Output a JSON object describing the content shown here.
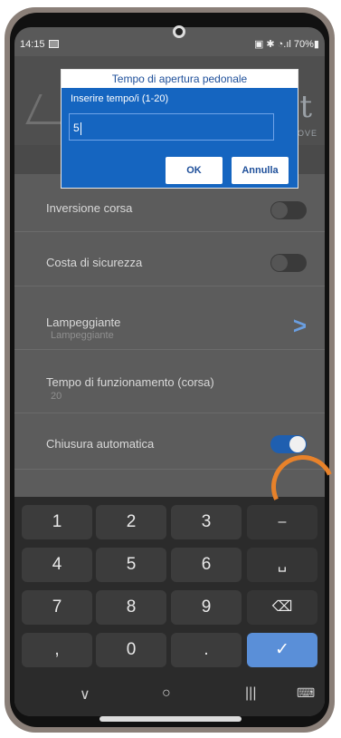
{
  "status": {
    "time": "14:15",
    "right": "▣ ✱ ◔.ıl 70%▮"
  },
  "header": {
    "logo_text": "t",
    "logo_sub": "OVE"
  },
  "dialog": {
    "title": "Tempo di apertura pedonale",
    "prompt": "Inserire tempo/i  (1-20)",
    "input_value": "5",
    "ok_label": "OK",
    "cancel_label": "Annulla"
  },
  "settings": {
    "items": [
      {
        "label": "Inversione corsa",
        "toggle": "off"
      },
      {
        "label": "Costa di sicurezza",
        "toggle": "off"
      },
      {
        "label": "Lampeggiante",
        "sub": "Lampeggiante",
        "chevron": "chevron-right-icon"
      },
      {
        "label": "Tempo di funzionamento (corsa)",
        "sub": "20"
      },
      {
        "label": "Chiusura automatica",
        "toggle": "on"
      }
    ]
  },
  "keyboard": {
    "rows": [
      [
        "1",
        "2",
        "3",
        "–"
      ],
      [
        "4",
        "5",
        "6",
        "␣"
      ],
      [
        "7",
        "8",
        "9",
        "⌫"
      ],
      [
        ",",
        "0",
        ".",
        "✓"
      ]
    ]
  },
  "navbar": {
    "back": "∨",
    "home": "○",
    "recents": "|||",
    "keyboard_icon": "⌨"
  },
  "colors": {
    "accent": "#1565c0",
    "toggle_on": "#1f5fb0",
    "highlight": "#e8822a"
  }
}
